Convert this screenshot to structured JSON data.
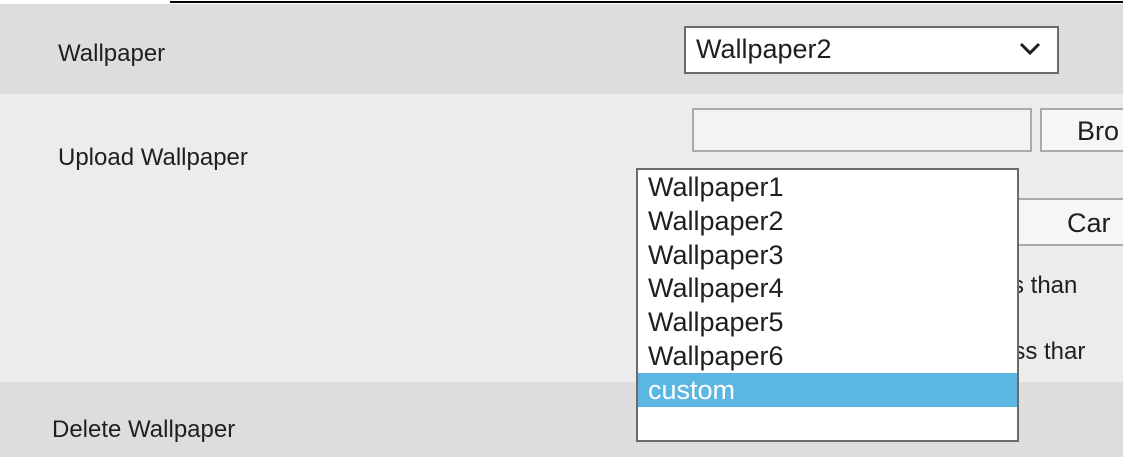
{
  "wallpaper": {
    "label": "Wallpaper",
    "selected": "Wallpaper2",
    "options": [
      "Wallpaper1",
      "Wallpaper2",
      "Wallpaper3",
      "Wallpaper4",
      "Wallpaper5",
      "Wallpaper6",
      "custom"
    ],
    "highlighted": "custom"
  },
  "upload": {
    "label": "Upload Wallpaper",
    "file_value": "",
    "browse_label": "Bro",
    "cancel_label": "Car",
    "hint1": "ss than",
    "hint2": "ess thar"
  },
  "delete": {
    "label": "Delete Wallpaper"
  },
  "colors": {
    "highlight": "#5cb6e2",
    "row_dark": "#dddddd",
    "row_light": "#ececec"
  },
  "icons": {
    "dropdown": "chevron-down-icon"
  }
}
